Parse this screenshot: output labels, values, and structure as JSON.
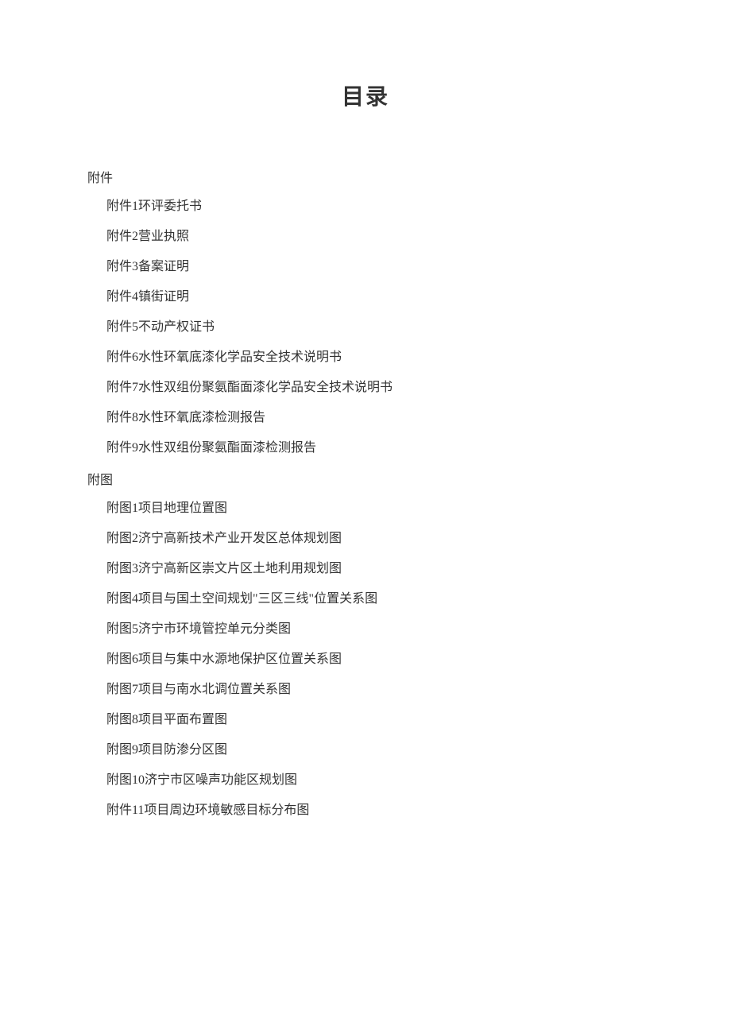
{
  "title": "目录",
  "sections": [
    {
      "heading": "附件",
      "items": [
        "附件1环评委托书",
        "附件2营业执照",
        "附件3备案证明",
        "附件4镇街证明",
        "附件5不动产权证书",
        "附件6水性环氧底漆化学品安全技术说明书",
        "附件7水性双组份聚氨酯面漆化学品安全技术说明书",
        "附件8水性环氧底漆检测报告",
        "附件9水性双组份聚氨酯面漆检测报告"
      ]
    },
    {
      "heading": "附图",
      "items": [
        "附图1项目地理位置图",
        "附图2济宁高新技术产业开发区总体规划图",
        "附图3济宁高新区崇文片区土地利用规划图",
        "附图4项目与国土空间规划\"三区三线\"位置关系图",
        "附图5济宁市环境管控单元分类图",
        "附图6项目与集中水源地保护区位置关系图",
        "附图7项目与南水北调位置关系图",
        "附图8项目平面布置图",
        "附图9项目防渗分区图",
        "附图10济宁市区噪声功能区规划图",
        "附件11项目周边环境敏感目标分布图"
      ]
    }
  ]
}
